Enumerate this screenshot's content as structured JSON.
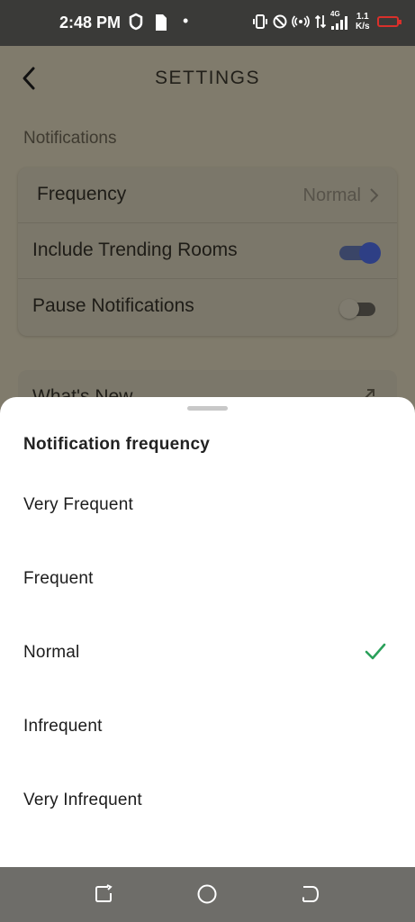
{
  "status_bar": {
    "time": "2:48 PM",
    "dot": "•",
    "speed_value": "1.1",
    "speed_unit": "K/s",
    "network": "4G",
    "icons": [
      "shield-icon",
      "sim-card-icon",
      "vibrate-icon",
      "do-not-disturb-icon",
      "hotspot-icon",
      "data-arrows-icon",
      "signal-icon",
      "battery-icon"
    ],
    "battery_color": "#d9302b"
  },
  "header": {
    "title": "SETTINGS",
    "back_icon": "chevron-left-icon"
  },
  "notifications_section": {
    "label": "Notifications",
    "rows": [
      {
        "label": "Frequency",
        "value": "Normal"
      },
      {
        "label": "Include Trending Rooms",
        "toggle": true
      },
      {
        "label": "Pause Notifications",
        "toggle": false
      }
    ]
  },
  "second_card": {
    "label": "What's New",
    "icon": "external-link-icon"
  },
  "sheet": {
    "title": "Notification frequency",
    "options": [
      {
        "label": "Very Frequent",
        "selected": false
      },
      {
        "label": "Frequent",
        "selected": false
      },
      {
        "label": "Normal",
        "selected": true
      },
      {
        "label": "Infrequent",
        "selected": false
      },
      {
        "label": "Very Infrequent",
        "selected": false
      }
    ],
    "check_color": "#2aa05a"
  },
  "nav_bar": {
    "buttons": [
      "recents-icon",
      "home-icon",
      "back-icon"
    ]
  }
}
